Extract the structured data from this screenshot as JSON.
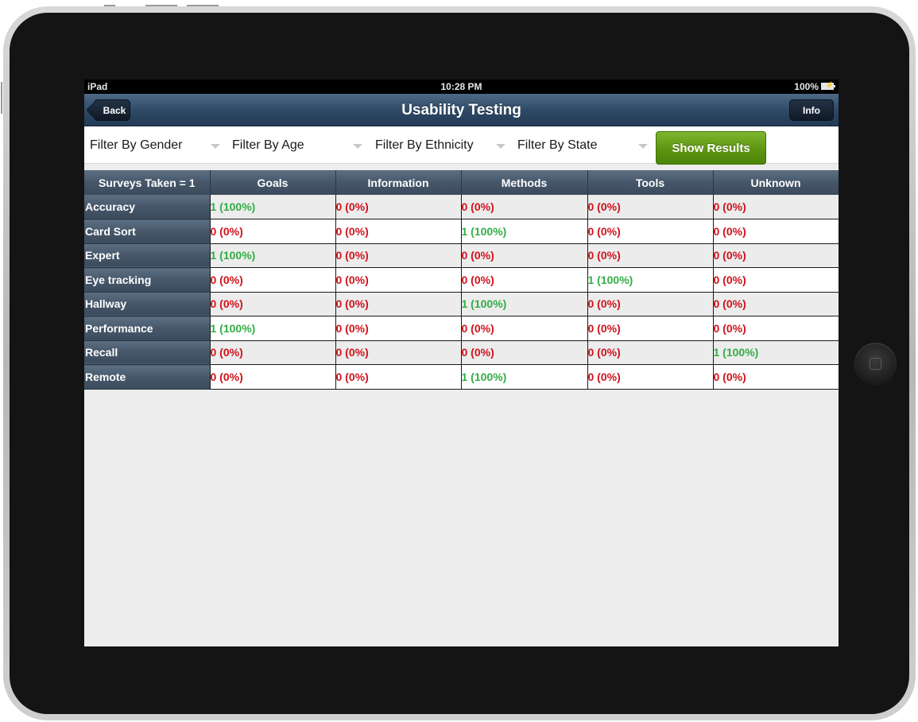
{
  "status_bar": {
    "carrier": "iPad",
    "time": "10:28 PM",
    "battery": "100%"
  },
  "nav": {
    "back_label": "Back",
    "title": "Usability Testing",
    "info_label": "Info"
  },
  "filters": [
    {
      "label": "Filter By Gender"
    },
    {
      "label": "Filter By Age"
    },
    {
      "label": "Filter By Ethnicity"
    },
    {
      "label": "Filter By State"
    }
  ],
  "show_results_label": "Show Results",
  "colors": {
    "zero": "#d1121b",
    "positive": "#32ad46",
    "accent_green": "#5d9512",
    "nav_blue": "#2f4a66"
  },
  "table": {
    "corner": "Surveys Taken = 1",
    "columns": [
      "Goals",
      "Information",
      "Methods",
      "Tools",
      "Unknown"
    ],
    "rows": [
      {
        "label": "Accuracy",
        "values": [
          "1 (100%)",
          "0 (0%)",
          "0 (0%)",
          "0 (0%)",
          "0 (0%)"
        ]
      },
      {
        "label": "Card Sort",
        "values": [
          "0 (0%)",
          "0 (0%)",
          "1 (100%)",
          "0 (0%)",
          "0 (0%)"
        ]
      },
      {
        "label": "Expert",
        "values": [
          "1 (100%)",
          "0 (0%)",
          "0 (0%)",
          "0 (0%)",
          "0 (0%)"
        ]
      },
      {
        "label": "Eye tracking",
        "values": [
          "0 (0%)",
          "0 (0%)",
          "0 (0%)",
          "1 (100%)",
          "0 (0%)"
        ]
      },
      {
        "label": "Hallway",
        "values": [
          "0 (0%)",
          "0 (0%)",
          "1 (100%)",
          "0 (0%)",
          "0 (0%)"
        ]
      },
      {
        "label": "Performance",
        "values": [
          "1 (100%)",
          "0 (0%)",
          "0 (0%)",
          "0 (0%)",
          "0 (0%)"
        ]
      },
      {
        "label": "Recall",
        "values": [
          "0 (0%)",
          "0 (0%)",
          "0 (0%)",
          "0 (0%)",
          "1 (100%)"
        ]
      },
      {
        "label": "Remote",
        "values": [
          "0 (0%)",
          "0 (0%)",
          "1 (100%)",
          "0 (0%)",
          "0 (0%)"
        ]
      }
    ]
  }
}
